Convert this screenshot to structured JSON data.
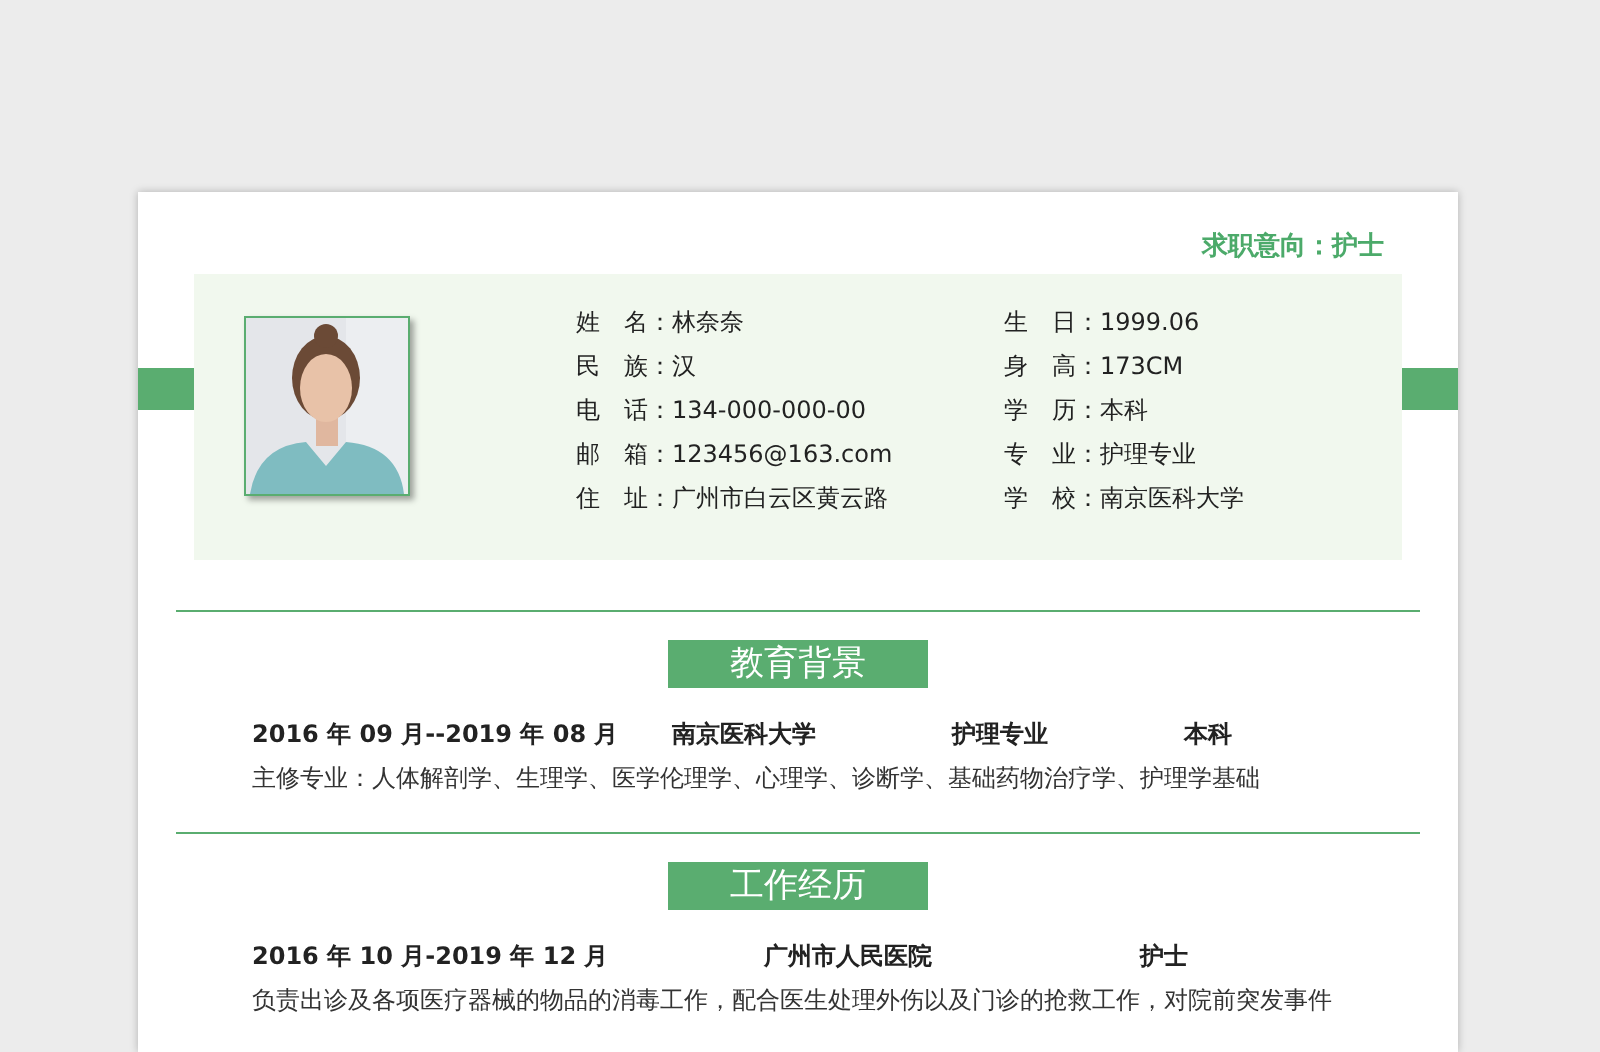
{
  "job_target": "求职意向：护士",
  "info": [
    {
      "label": "姓　名：",
      "value": "林奈奈"
    },
    {
      "label": "生　日：",
      "value": "1999.06"
    },
    {
      "label": "民　族：",
      "value": "汉"
    },
    {
      "label": "身　高：",
      "value": "173CM"
    },
    {
      "label": "电　话：",
      "value": "134-000-000-00"
    },
    {
      "label": "学　历：",
      "value": "本科"
    },
    {
      "label": "邮　箱：",
      "value": "123456@163.com"
    },
    {
      "label": "专　业：",
      "value": "护理专业"
    },
    {
      "label": "住　址：",
      "value": "广州市白云区黄云路"
    },
    {
      "label": "学　校：",
      "value": "南京医科大学"
    }
  ],
  "sections": [
    {
      "title": "教育背景",
      "row": [
        "2016 年 09 月--2019 年 08 月",
        "南京医科大学",
        "护理专业",
        "本科"
      ],
      "text": "主修专业：人体解剖学、生理学、医学伦理学、心理学、诊断学、基础药物治疗学、护理学基础"
    },
    {
      "title": "工作经历",
      "row": [
        "2016 年 10 月-2019 年 12 月",
        "广州市人民医院",
        "护士"
      ],
      "text": "负责出诊及各项医疗器械的物品的消毒工作，配合医生处理外伤以及门诊的抢救工作，对院前突发事件"
    }
  ]
}
